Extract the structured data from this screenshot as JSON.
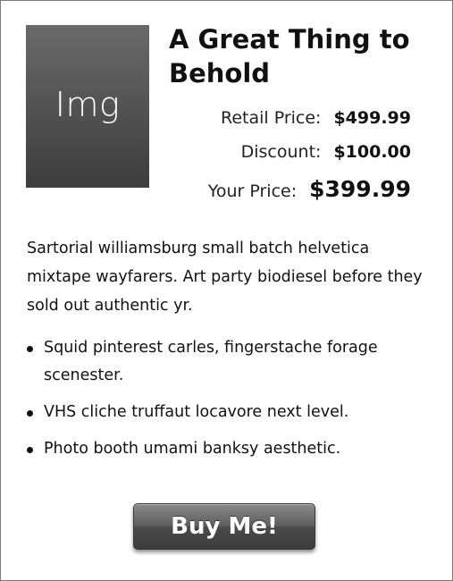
{
  "product": {
    "image_placeholder": "Img",
    "title": "A Great Thing to Behold",
    "prices": {
      "retail_label": "Retail Price:",
      "retail_value": "$499.99",
      "discount_label": "Discount:",
      "discount_value": "$100.00",
      "your_label": "Your Price:",
      "your_value": "$399.99"
    },
    "description": "Sartorial williamsburg small batch helvetica mixtape wayfarers. Art party biodiesel before they sold out authentic yr.",
    "features": [
      "Squid pinterest carles, fingerstache forage scenester.",
      "VHS cliche truffaut locavore next level.",
      "Photo booth umami banksy aesthetic."
    ],
    "buy_label": "Buy Me!"
  }
}
